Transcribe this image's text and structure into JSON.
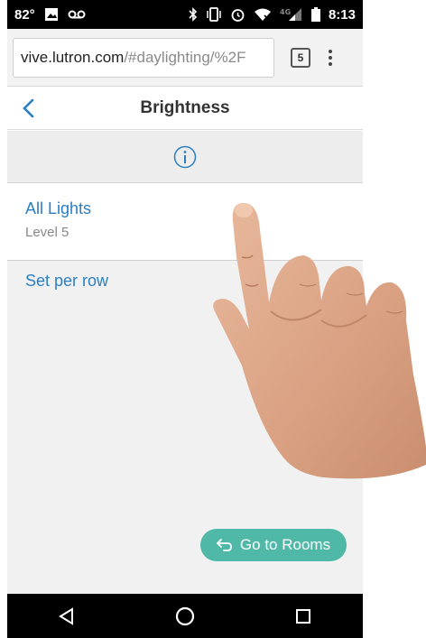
{
  "status_bar": {
    "temperature": "82°",
    "time": "8:13",
    "network": "4G",
    "icons": [
      "image-icon",
      "voicemail-icon",
      "bluetooth-icon",
      "vibrate-icon",
      "alarm-icon",
      "wifi-off-icon",
      "signal-icon",
      "battery-icon"
    ]
  },
  "browser": {
    "url_host": "vive.lutron.com",
    "url_path": "/#daylighting/%2F",
    "tab_count": "5"
  },
  "app_header": {
    "title": "Brightness"
  },
  "rows": [
    {
      "title": "All Lights",
      "subtitle": "Level 5"
    },
    {
      "title": "Set per row"
    }
  ],
  "buttons": {
    "go_to_rooms": "Go to Rooms"
  },
  "colors": {
    "accent_blue": "#2a7fc1",
    "teal_button": "#4fb8a7",
    "band_gray": "#ededed"
  }
}
